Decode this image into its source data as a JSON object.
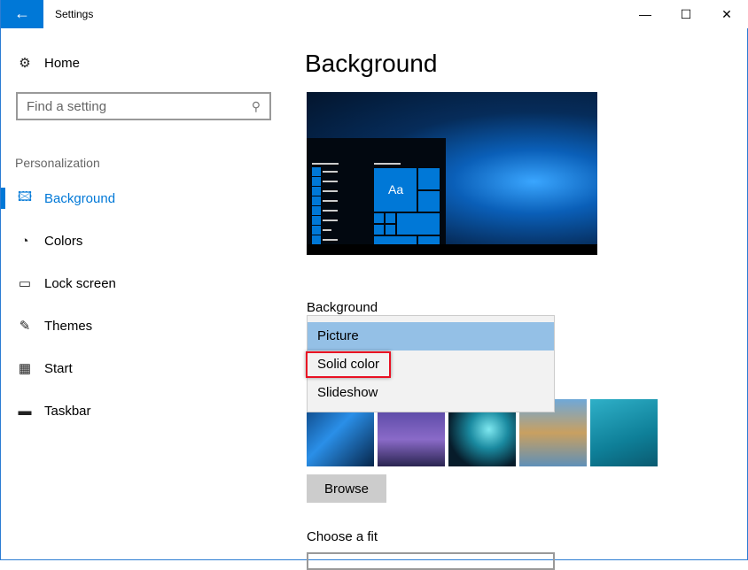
{
  "window": {
    "title": "Settings",
    "back_icon": "←",
    "minimize": "—",
    "maximize": "☐",
    "close": "✕"
  },
  "sidebar": {
    "home": "Home",
    "search_placeholder": "Find a setting",
    "section": "Personalization",
    "items": [
      {
        "label": "Background",
        "icon": "picture-icon",
        "glyph": "🖾"
      },
      {
        "label": "Colors",
        "icon": "palette-icon",
        "glyph": "◔"
      },
      {
        "label": "Lock screen",
        "icon": "lock-screen-icon",
        "glyph": "▭"
      },
      {
        "label": "Themes",
        "icon": "themes-icon",
        "glyph": "✎"
      },
      {
        "label": "Start",
        "icon": "start-icon",
        "glyph": "▦"
      },
      {
        "label": "Taskbar",
        "icon": "taskbar-icon",
        "glyph": "▬"
      }
    ],
    "active": "Background"
  },
  "main": {
    "title": "Background",
    "preview_tile_text": "Aa",
    "background_label": "Background",
    "options": [
      "Picture",
      "Solid color",
      "Slideshow"
    ],
    "selected": "Picture",
    "highlighted": "Solid color",
    "browse": "Browse",
    "fit_label": "Choose a fit"
  },
  "colors": {
    "accent": "#0078d7",
    "highlight_box": "#e81123",
    "selected_option": "#94c0e6"
  }
}
